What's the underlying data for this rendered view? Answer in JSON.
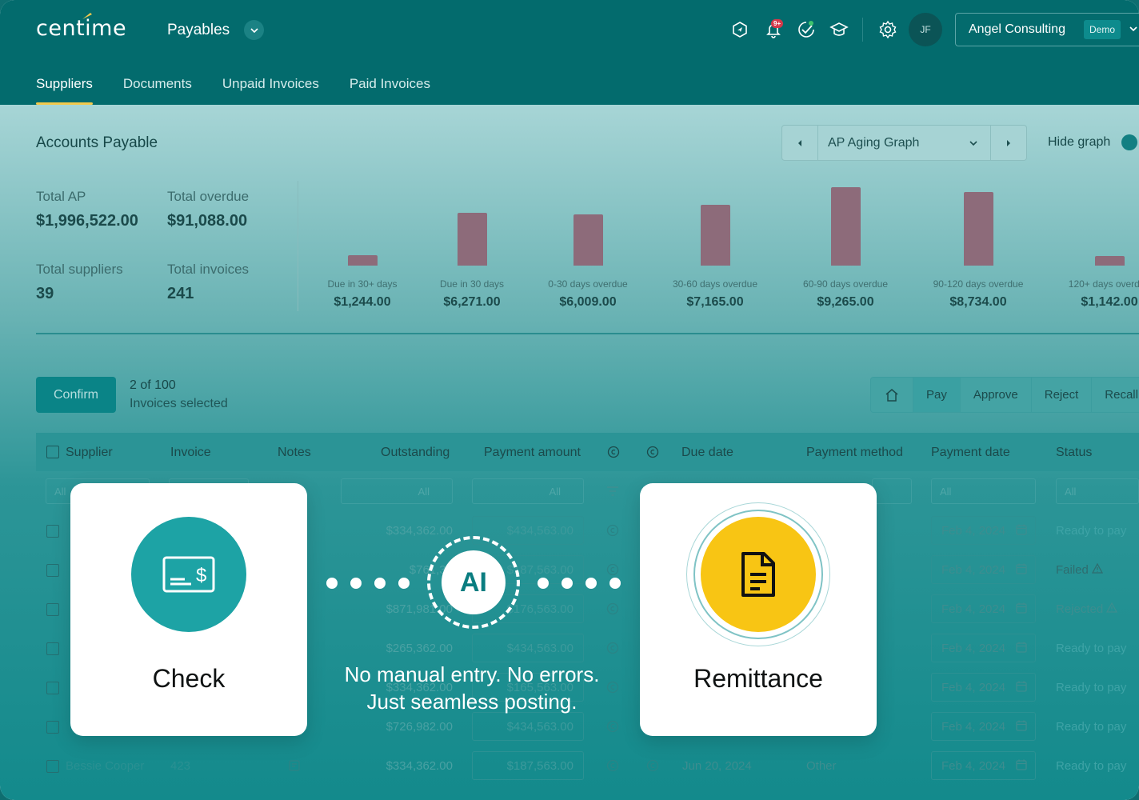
{
  "brand": {
    "logo_text": "centime",
    "module": "Payables"
  },
  "header": {
    "notification_badge": "9+",
    "avatar_initials": "JF",
    "account_name": "Angel Consulting",
    "account_tag": "Demo"
  },
  "tabs": [
    {
      "label": "Suppliers",
      "active": true
    },
    {
      "label": "Documents",
      "active": false
    },
    {
      "label": "Unpaid Invoices",
      "active": false
    },
    {
      "label": "Paid Invoices",
      "active": false
    }
  ],
  "summary": {
    "title": "Accounts Payable",
    "graph_select": "AP Aging Graph",
    "hide_graph": "Hide graph",
    "total_ap_label": "Total AP",
    "total_ap_value": "$1,996,522.00",
    "total_overdue_label": "Total overdue",
    "total_overdue_value": "$91,088.00",
    "total_suppliers_label": "Total suppliers",
    "total_suppliers_value": "39",
    "total_invoices_label": "Total invoices",
    "total_invoices_value": "241"
  },
  "chart_data": {
    "type": "bar",
    "categories": [
      "Due in 30+ days",
      "Due in 30 days",
      "0-30 days overdue",
      "30-60 days overdue",
      "60-90 days overdue",
      "90-120 days overdue",
      "120+ days overdue"
    ],
    "values": [
      1244,
      6271,
      6009,
      7165,
      9265,
      8734,
      1142
    ],
    "value_labels": [
      "$1,244.00",
      "$6,271.00",
      "$6,009.00",
      "$7,165.00",
      "$9,265.00",
      "$8,734.00",
      "$1,142.00"
    ],
    "bar_color": "#8d6b7a"
  },
  "selection": {
    "confirm_label": "Confirm",
    "count": "2 of 100",
    "text": "Invoices selected"
  },
  "actions": [
    "Pay",
    "Approve",
    "Reject",
    "Recall"
  ],
  "table": {
    "columns": [
      "Supplier",
      "Invoice",
      "Notes",
      "Outstanding",
      "Payment amount",
      "Due date",
      "Payment method",
      "Payment date",
      "Status"
    ],
    "filter_all": "All",
    "rows": [
      {
        "outstanding": "$334,362.00",
        "amount": "$434,563.00",
        "date": "Feb 4, 2024",
        "status": "Ready to pay"
      },
      {
        "outstanding": "$761,36",
        "amount": "$187,563.00",
        "date": "Feb 4, 2024",
        "status": "Failed"
      },
      {
        "outstanding": "$871,981.00",
        "amount": "$176,563.00",
        "date": "Feb 4, 2024",
        "status": "Rejected"
      },
      {
        "outstanding": "$265,362.00",
        "amount": "$434,563.00",
        "date": "Feb 4, 2024",
        "status": "Ready to pay"
      },
      {
        "outstanding": "$334,362.00",
        "amount": "$165,563.00",
        "date": "Feb 4, 2024",
        "status": "Ready to pay"
      },
      {
        "outstanding": "$726,982.00",
        "amount": "$434,563.00",
        "date": "Feb 4, 2024",
        "status": "Ready to pay"
      },
      {
        "supplier": "Bessie Cooper",
        "invoice": "423",
        "outstanding": "$334,362.00",
        "amount": "$187,563.00",
        "due": "Jun 20, 2024",
        "method": "Other",
        "date": "Feb 4, 2024",
        "status": "Ready to pay"
      }
    ]
  },
  "overlay": {
    "check_label": "Check",
    "remittance_label": "Remittance",
    "ai_label": "AI",
    "tagline_1": "No manual entry. No errors.",
    "tagline_2": "Just seamless posting."
  }
}
